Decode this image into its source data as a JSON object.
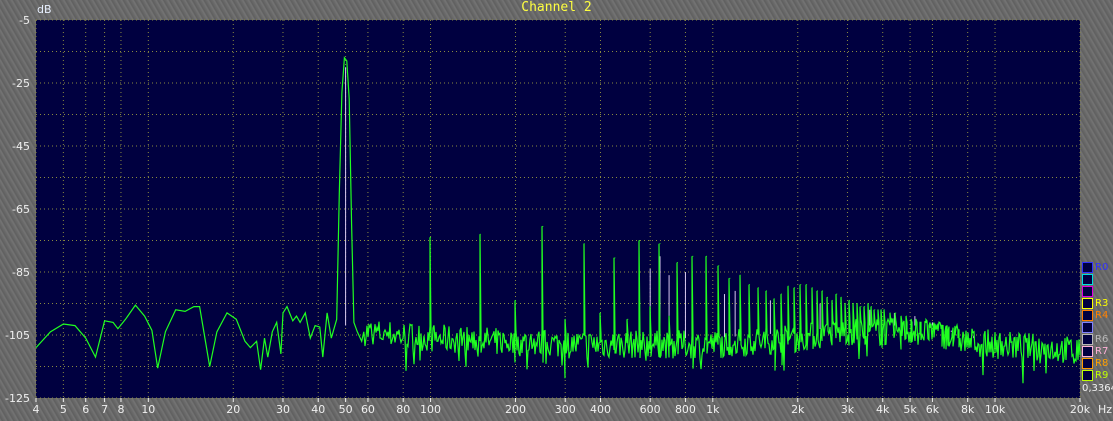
{
  "window": {
    "title": "Channel 2"
  },
  "legend": [
    {
      "label": "R0",
      "color": "#3030ff"
    },
    {
      "label": "",
      "color": "#00e0e0"
    },
    {
      "label": "",
      "color": "#e000e0"
    },
    {
      "label": "R3",
      "color": "#ffff00"
    },
    {
      "label": "R4",
      "color": "#ff8000"
    },
    {
      "label": "",
      "color": "#8080ff"
    },
    {
      "label": "R6",
      "color": "#b8b8b8"
    },
    {
      "label": "R7",
      "color": "#ffb0d8"
    },
    {
      "label": "R8",
      "color": "#ffa000"
    },
    {
      "label": "R9",
      "color": "#c0ff00"
    }
  ],
  "readout": "0,3364",
  "chart_data": {
    "type": "line",
    "title": "Channel 2",
    "ylabel": "dB",
    "xlabel": "Hz",
    "xscale": "log",
    "xlim": [
      4,
      20000
    ],
    "ylim": [
      -125,
      -5
    ],
    "grid": true,
    "background": "#000040",
    "grid_color": "#8a8a40",
    "yticks": [
      -5,
      -25,
      -45,
      -65,
      -85,
      -105,
      -125
    ],
    "xticks": [
      {
        "v": 4,
        "l": "4"
      },
      {
        "v": 5,
        "l": "5"
      },
      {
        "v": 6,
        "l": "6"
      },
      {
        "v": 7,
        "l": "7"
      },
      {
        "v": 8,
        "l": "8"
      },
      {
        "v": 10,
        "l": "10"
      },
      {
        "v": 20,
        "l": "20"
      },
      {
        "v": 30,
        "l": "30"
      },
      {
        "v": 40,
        "l": "40"
      },
      {
        "v": 50,
        "l": "50"
      },
      {
        "v": 60,
        "l": "60"
      },
      {
        "v": 80,
        "l": "80"
      },
      {
        "v": 100,
        "l": "100"
      },
      {
        "v": 200,
        "l": "200"
      },
      {
        "v": 300,
        "l": "300"
      },
      {
        "v": 400,
        "l": "400"
      },
      {
        "v": 600,
        "l": "600"
      },
      {
        "v": 800,
        "l": "800"
      },
      {
        "v": 1000,
        "l": "1k"
      },
      {
        "v": 2000,
        "l": "2k"
      },
      {
        "v": 3000,
        "l": "3k"
      },
      {
        "v": 4000,
        "l": "4k"
      },
      {
        "v": 5000,
        "l": "5k"
      },
      {
        "v": 6000,
        "l": "6k"
      },
      {
        "v": 8000,
        "l": "8k"
      },
      {
        "v": 10000,
        "l": "10k"
      },
      {
        "v": 20000,
        "l": "20k"
      }
    ],
    "series": [
      {
        "color": "#20ff20",
        "points": [
          [
            4,
            -109
          ],
          [
            4.5,
            -104
          ],
          [
            5,
            -101.5
          ],
          [
            5.5,
            -102
          ],
          [
            6,
            -106
          ],
          [
            6.5,
            -112
          ],
          [
            7,
            -100.5
          ],
          [
            7.5,
            -101
          ],
          [
            7.8,
            -103
          ],
          [
            8.3,
            -100
          ],
          [
            9,
            -95.5
          ],
          [
            9.7,
            -99
          ],
          [
            10.3,
            -103.5
          ],
          [
            10.8,
            -115.5
          ],
          [
            11.5,
            -104
          ],
          [
            12.5,
            -97
          ],
          [
            13.5,
            -97.5
          ],
          [
            14.5,
            -96
          ],
          [
            15.2,
            -96
          ],
          [
            16.5,
            -115
          ],
          [
            17.5,
            -104
          ],
          [
            19,
            -98
          ],
          [
            20.5,
            -100
          ],
          [
            22,
            -107
          ],
          [
            23,
            -109
          ],
          [
            24.2,
            -107
          ],
          [
            25,
            -116
          ],
          [
            25.8,
            -106
          ],
          [
            26.5,
            -112
          ],
          [
            27.5,
            -104
          ],
          [
            28.5,
            -101
          ],
          [
            29.5,
            -111
          ],
          [
            30,
            -98
          ],
          [
            31,
            -96
          ],
          [
            32.5,
            -100.5
          ],
          [
            33.5,
            -99
          ],
          [
            34.5,
            -101
          ],
          [
            36,
            -98
          ],
          [
            37.5,
            -106
          ],
          [
            39,
            -102
          ],
          [
            40.5,
            -102.5
          ],
          [
            41.5,
            -112
          ],
          [
            43,
            -98
          ],
          [
            44.5,
            -106
          ],
          [
            45.5,
            -103
          ],
          [
            46.5,
            -100
          ],
          [
            47.5,
            -60
          ],
          [
            48.5,
            -28
          ],
          [
            49.5,
            -17
          ],
          [
            50.5,
            -18
          ],
          [
            51.5,
            -30
          ],
          [
            52.5,
            -70
          ],
          [
            53.5,
            -101
          ],
          [
            55,
            -104
          ],
          [
            57,
            -107
          ],
          [
            58,
            -104
          ]
        ],
        "harmonics": [
          [
            100,
            -74
          ],
          [
            150,
            -73
          ],
          [
            200,
            -94
          ],
          [
            250,
            -70.5
          ],
          [
            300,
            -100
          ],
          [
            350,
            -76
          ],
          [
            400,
            -98
          ],
          [
            450,
            -80.5
          ],
          [
            500,
            -100
          ],
          [
            550,
            -75
          ],
          [
            600,
            -96
          ],
          [
            650,
            -76
          ],
          [
            700,
            -99
          ],
          [
            750,
            -82
          ],
          [
            850,
            -80
          ],
          [
            950,
            -80
          ],
          [
            1050,
            -83
          ],
          [
            1150,
            -87
          ],
          [
            1250,
            -86
          ],
          [
            1350,
            -89
          ],
          [
            1450,
            -90
          ],
          [
            1550,
            -91
          ],
          [
            1650,
            -93.5
          ],
          [
            1750,
            -92
          ],
          [
            1850,
            -89.5
          ],
          [
            1950,
            -90
          ],
          [
            2050,
            -89
          ],
          [
            2150,
            -89
          ],
          [
            2250,
            -90
          ],
          [
            2350,
            -91
          ],
          [
            2450,
            -91
          ],
          [
            2550,
            -93
          ],
          [
            2650,
            -94
          ],
          [
            2750,
            -92
          ],
          [
            2850,
            -93
          ],
          [
            2950,
            -95
          ],
          [
            3050,
            -94
          ],
          [
            3150,
            -95
          ],
          [
            3250,
            -95
          ],
          [
            3350,
            -96
          ],
          [
            3450,
            -96
          ],
          [
            3550,
            -95
          ],
          [
            3650,
            -96
          ],
          [
            3750,
            -97
          ],
          [
            3850,
            -97
          ],
          [
            3950,
            -97
          ],
          [
            4050,
            -97
          ],
          [
            4250,
            -98
          ],
          [
            4450,
            -98
          ],
          [
            4650,
            -99
          ],
          [
            4850,
            -99
          ],
          [
            5050,
            -100
          ],
          [
            5250,
            -100
          ],
          [
            5450,
            -101
          ],
          [
            5650,
            -101
          ],
          [
            5850,
            -102
          ],
          [
            6050,
            -102
          ],
          [
            6250,
            -103
          ],
          [
            6450,
            -103
          ],
          [
            6650,
            -104
          ],
          [
            6850,
            -104
          ],
          [
            7050,
            -105
          ],
          [
            7250,
            -105
          ],
          [
            7450,
            -106
          ]
        ],
        "noise_floor": [
          [
            58,
            -104
          ],
          [
            100,
            -106
          ],
          [
            300,
            -108
          ],
          [
            1000,
            -108
          ],
          [
            2000,
            -106
          ],
          [
            3000,
            -104
          ],
          [
            6000,
            -104
          ],
          [
            8000,
            -107
          ],
          [
            10000,
            -108
          ],
          [
            20000,
            -110
          ]
        ]
      },
      {
        "color": "#d8c8f0",
        "harmonics": [
          [
            50,
            -20
          ],
          [
            600,
            -84
          ],
          [
            650,
            -80
          ],
          [
            700,
            -86
          ],
          [
            800,
            -85
          ],
          [
            1100,
            -92
          ],
          [
            1200,
            -91
          ],
          [
            1600,
            -94
          ],
          [
            2400,
            -95
          ],
          [
            3600,
            -97
          ],
          [
            4400,
            -98
          ],
          [
            5200,
            -99
          ],
          [
            6000,
            -101
          ],
          [
            7000,
            -104
          ],
          [
            8400,
            -106
          ]
        ]
      }
    ]
  }
}
